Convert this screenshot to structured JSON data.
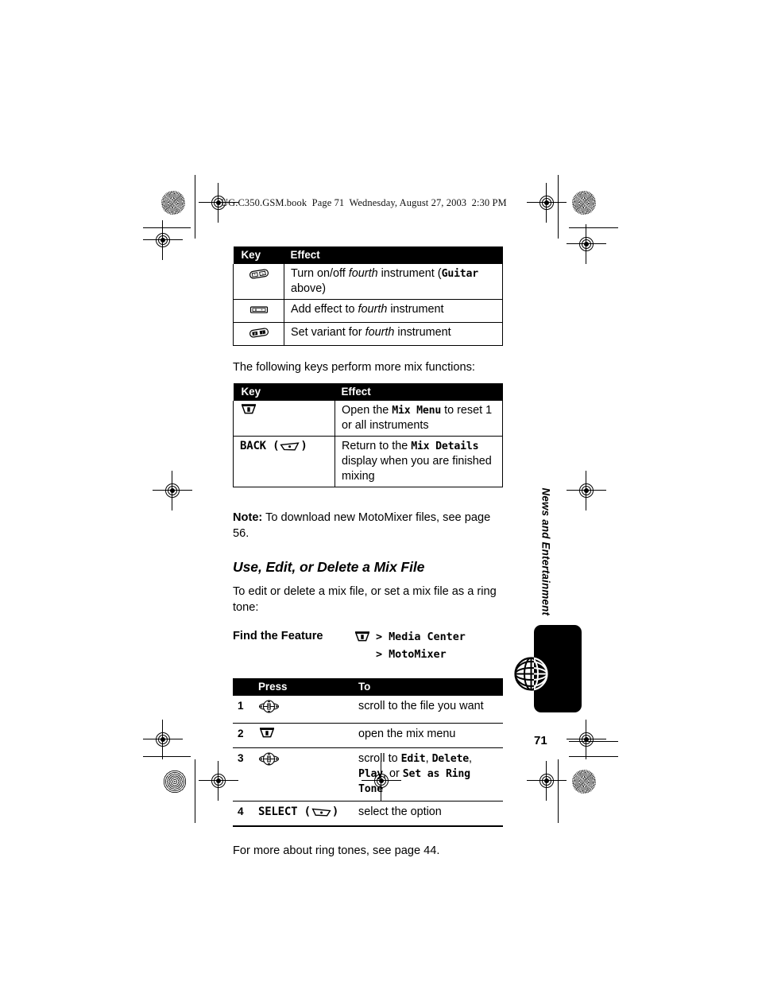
{
  "header": {
    "book_line": "UG.C350.GSM.book  Page 71  Wednesday, August 27, 2003  2:30 PM"
  },
  "table_keys_1": {
    "columns": [
      "Key",
      "Effect"
    ],
    "rows": [
      {
        "key_icon": "star-key-icon",
        "effect_pre": "Turn on/off ",
        "effect_em": "fourth",
        "effect_mid": " instrument (",
        "effect_mono": "Guitar",
        "effect_post": " above)"
      },
      {
        "key_icon": "zero-plus-key-icon",
        "effect_pre": "Add effect to ",
        "effect_em": "fourth",
        "effect_mid": " instrument",
        "effect_mono": "",
        "effect_post": ""
      },
      {
        "key_icon": "pound-key-icon",
        "effect_pre": "Set variant for ",
        "effect_em": "fourth",
        "effect_mid": " instrument",
        "effect_mono": "",
        "effect_post": ""
      }
    ]
  },
  "intro_more_keys": "The following keys perform more mix functions:",
  "table_keys_2": {
    "columns": [
      "Key",
      "Effect"
    ],
    "rows": [
      {
        "key_icon": "menu-key-icon",
        "key_label": "",
        "effect_pre": "Open the ",
        "effect_mono": "Mix Menu",
        "effect_post": " to reset 1 or all instruments"
      },
      {
        "key_icon": "softkey-icon",
        "key_label": "BACK",
        "effect_pre": "Return to the ",
        "effect_mono": "Mix Details",
        "effect_post": " display when you are finished mixing"
      }
    ]
  },
  "note": {
    "label": "Note:",
    "text": " To download new MotoMixer files, see page 56."
  },
  "section_heading": "Use, Edit, or Delete a Mix File",
  "section_intro": "To edit or delete a mix file, or set a mix file as a ring tone:",
  "find_the_feature": {
    "label": "Find the Feature",
    "icon": "menu-key-icon",
    "path_line_1": "> Media Center",
    "path_line_2": "> MotoMixer"
  },
  "steps_table": {
    "columns": [
      "",
      "Press",
      "To"
    ],
    "rows": [
      {
        "num": "1",
        "press_icon": "nav-key-icon",
        "press_label": "",
        "to_pre": "scroll to the file you want",
        "to_mono_1": "",
        "to_sep_1": "",
        "to_mono_2": "",
        "to_sep_2": "",
        "to_mono_3": "",
        "to_sep_3": "",
        "to_mono_4": ""
      },
      {
        "num": "2",
        "press_icon": "menu-key-icon",
        "press_label": "",
        "to_pre": "open the mix menu",
        "to_mono_1": "",
        "to_sep_1": "",
        "to_mono_2": "",
        "to_sep_2": "",
        "to_mono_3": "",
        "to_sep_3": "",
        "to_mono_4": ""
      },
      {
        "num": "3",
        "press_icon": "nav-key-icon",
        "press_label": "",
        "to_pre": "scroll to ",
        "to_mono_1": "Edit",
        "to_sep_1": ", ",
        "to_mono_2": "Delete",
        "to_sep_2": ", ",
        "to_mono_3": "Play",
        "to_sep_3": ", or ",
        "to_mono_4": "Set as Ring Tone"
      },
      {
        "num": "4",
        "press_icon": "softkey-icon",
        "press_label": "SELECT",
        "to_pre": "select the option",
        "to_mono_1": "",
        "to_sep_1": "",
        "to_mono_2": "",
        "to_sep_2": "",
        "to_mono_3": "",
        "to_sep_3": "",
        "to_mono_4": ""
      }
    ]
  },
  "closing_text": "For more about ring tones, see page 44.",
  "side_tab": {
    "label": "News and Entertainment",
    "icon": "globe-icon"
  },
  "page_number": "71",
  "colors": {
    "ink": "#000000",
    "paper": "#ffffff",
    "header_bar": "#000000"
  }
}
